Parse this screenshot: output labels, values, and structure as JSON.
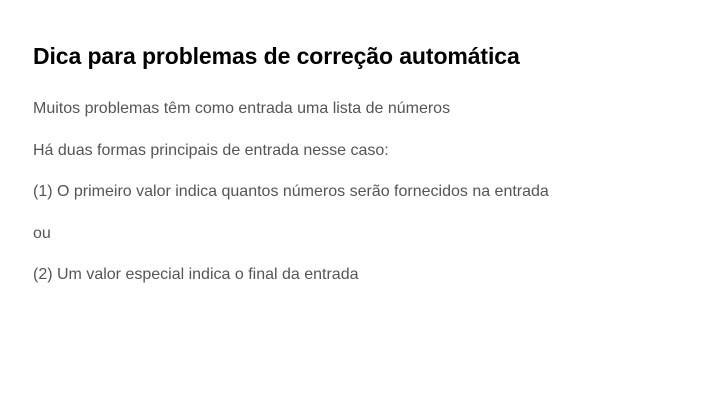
{
  "slide": {
    "title": "Dica para problemas de correção automática",
    "lines": [
      "Muitos problemas têm como entrada uma lista de números",
      "Há duas formas principais de entrada nesse caso:",
      "(1) O primeiro valor indica quantos números serão fornecidos na entrada",
      "ou",
      "(2) Um valor especial indica o final da entrada"
    ]
  },
  "colors": {
    "title": "#000000",
    "body_text": "#555555",
    "background": "#ffffff"
  }
}
